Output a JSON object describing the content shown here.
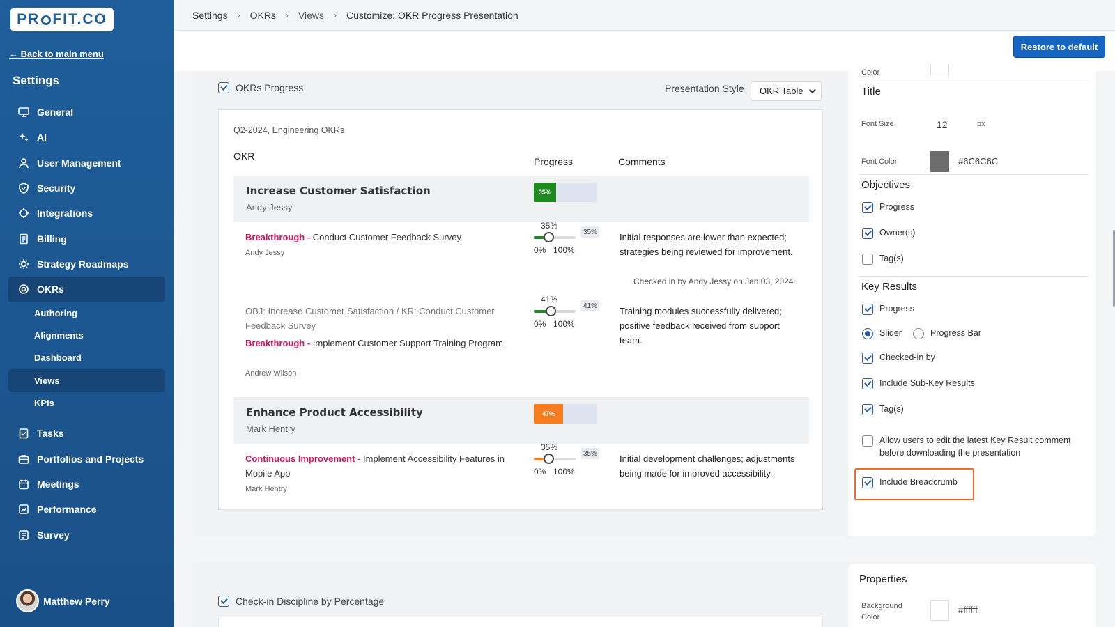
{
  "brand": {
    "logo_left": "PR",
    "logo_right": "FIT.CO"
  },
  "sidebar": {
    "back_link": "← Back to main menu",
    "title": "Settings",
    "items": [
      {
        "label": "General",
        "icon": "monitor-icon"
      },
      {
        "label": "AI",
        "icon": "sparkle-icon"
      },
      {
        "label": "User Management",
        "icon": "user-icon"
      },
      {
        "label": "Security",
        "icon": "shield-icon"
      },
      {
        "label": "Integrations",
        "icon": "puzzle-icon"
      },
      {
        "label": "Billing",
        "icon": "receipt-icon"
      },
      {
        "label": "Strategy Roadmaps",
        "icon": "bulb-icon"
      },
      {
        "label": "OKRs",
        "icon": "target-icon"
      }
    ],
    "okr_subitems": [
      "Authoring",
      "Alignments",
      "Dashboard",
      "Views",
      "KPIs"
    ],
    "items_after": [
      {
        "label": "Tasks",
        "icon": "task-icon"
      },
      {
        "label": "Portfolios and Projects",
        "icon": "briefcase-icon"
      },
      {
        "label": "Meetings",
        "icon": "calendar-icon"
      },
      {
        "label": "Performance",
        "icon": "chart-icon"
      },
      {
        "label": "Survey",
        "icon": "survey-icon"
      }
    ],
    "user_name": "Matthew Perry"
  },
  "breadcrumb": [
    "Settings",
    "OKRs",
    "Views",
    "Customize: OKR Progress Presentation"
  ],
  "toolbar": {
    "restore_label": "Restore to default"
  },
  "section1": {
    "checkbox_label": "OKRs Progress",
    "presentation_style_label": "Presentation Style",
    "presentation_style_value": "OKR Table"
  },
  "preview": {
    "subtitle": "Q2-2024, Engineering OKRs",
    "col_okr": "OKR",
    "col_progress": "Progress",
    "col_comments": "Comments",
    "objectives": [
      {
        "title": "Increase Customer Satisfaction",
        "owner": "Andy Jessy",
        "progress": 35,
        "progress_label": "35%",
        "color": "#1e8a1e"
      },
      {
        "title": "Enhance Product Accessibility",
        "owner": "Mark Hentry",
        "progress": 47,
        "progress_label": "47%",
        "color": "#f57c1f"
      }
    ],
    "key_results": [
      {
        "tag": "Breakthrough",
        "sep": " - ",
        "title": "Conduct Customer Feedback Survey",
        "owner": "Andy Jessy",
        "progress": 35,
        "pct_label": "35%",
        "badge": "35%",
        "lo": "0%",
        "hi": "100%",
        "color": "#1e8a1e",
        "comment": "Initial responses are lower than expected; strategies being reviewed for improvement.",
        "checked_in": "Checked in by Andy Jessy on Jan 03, 2024"
      },
      {
        "path": "OBJ: Increase Customer Satisfaction / KR: Conduct Customer Feedback Survey",
        "tag": "Breakthrough",
        "sep": " - ",
        "title": "Implement Customer Support Training Program",
        "owner": "Andrew Wilson",
        "progress": 41,
        "pct_label": "41%",
        "badge": "41%",
        "lo": "0%",
        "hi": "100%",
        "color": "#1e8a1e",
        "comment": "Training modules successfully delivered; positive feedback received from support team."
      },
      {
        "tag": "Continuous Improvement",
        "sep": " - ",
        "title": "Implement Accessibility Features in Mobile App",
        "owner": "Mark Hentry",
        "progress": 35,
        "pct_label": "35%",
        "badge": "35%",
        "lo": "0%",
        "hi": "100%",
        "color": "#f57c1f",
        "comment": "Initial development challenges; adjustments being made for improved accessibility."
      }
    ]
  },
  "right_panel": {
    "color_label": "Color",
    "title_heading": "Title",
    "font_size_label": "Font Size",
    "font_size_value": "12",
    "font_size_unit": "px",
    "font_color_label": "Font Color",
    "font_color_value": "#6C6C6C",
    "objectives_heading": "Objectives",
    "obj_progress": "Progress",
    "obj_owners": "Owner(s)",
    "obj_tags": "Tag(s)",
    "kr_heading": "Key Results",
    "kr_progress": "Progress",
    "kr_slider": "Slider",
    "kr_progress_bar": "Progress Bar",
    "kr_checked_in": "Checked-in by",
    "kr_sub_kr": "Include Sub-Key Results",
    "kr_tags": "Tag(s)",
    "kr_allow_edit": "Allow users to edit the latest Key Result comment before downloading the presentation",
    "kr_breadcrumb": "Include Breadcrumb"
  },
  "section2": {
    "checkbox_label": "Check-in Discipline by Percentage",
    "properties_heading": "Properties",
    "bg_color_label": "Background Color",
    "bg_color_value": "#ffffff"
  },
  "colors": {
    "sidebar": "#1f5e9a",
    "accent": "#1565c0",
    "highlight": "#f26b21",
    "tag": "#d6175f"
  }
}
